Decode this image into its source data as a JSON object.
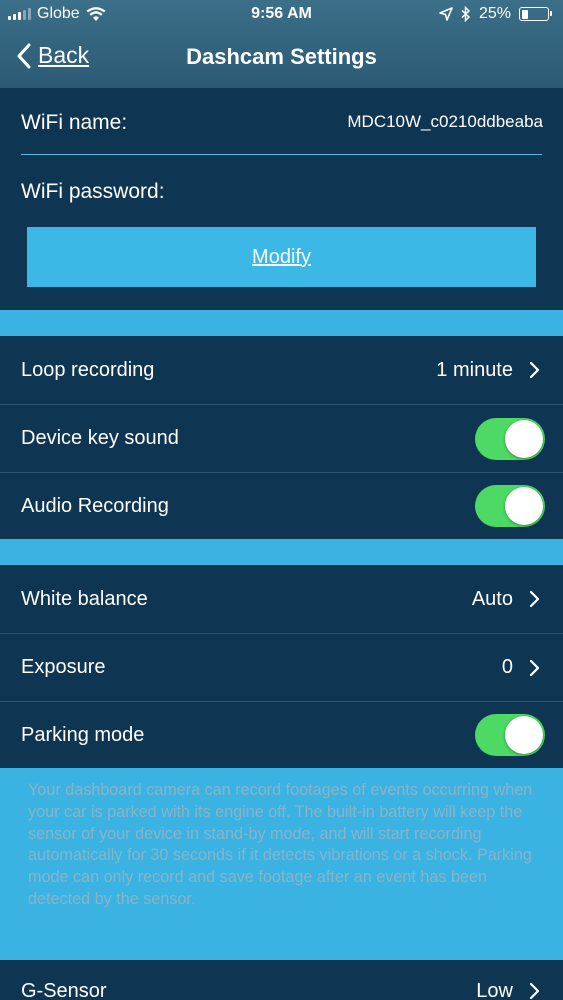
{
  "status_bar": {
    "carrier": "Globe",
    "time": "9:56 AM",
    "battery": "25%",
    "battery_level": 0.25
  },
  "nav": {
    "back_label": "Back",
    "title": "Dashcam Settings"
  },
  "wifi": {
    "name_label": "WiFi name:",
    "name_value": "MDC10W_c0210ddbeaba",
    "password_label": "WiFi password:",
    "modify_label": "Modify"
  },
  "settings": {
    "loop_recording": {
      "label": "Loop recording",
      "value": "1 minute"
    },
    "device_key_sound": {
      "label": "Device key sound",
      "enabled": true
    },
    "audio_recording": {
      "label": "Audio Recording",
      "enabled": true
    },
    "white_balance": {
      "label": "White balance",
      "value": "Auto"
    },
    "exposure": {
      "label": "Exposure",
      "value": "0"
    },
    "parking_mode": {
      "label": "Parking mode",
      "enabled": true
    },
    "parking_note": "Your dashboard camera can record footages of events occurring when your car is parked with its engine off. The built-in battery will keep the sensor of your device in stand-by mode, and will start recording automatically for 30 seconds if it detects vibrations or a shock. Parking mode can only record and save footage after an event has been detected by the sensor.",
    "g_sensor": {
      "label": "G-Sensor",
      "value": "Low"
    }
  },
  "colors": {
    "background": "#0e3552",
    "accent": "#3ab2e2",
    "toggle_on": "#4cd964"
  }
}
